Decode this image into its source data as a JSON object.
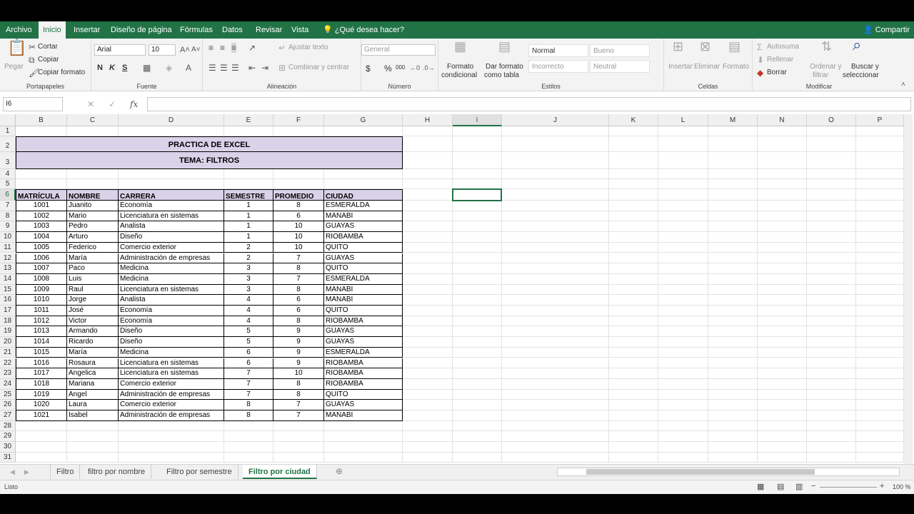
{
  "ribbon_tabs": [
    "Archivo",
    "Inicio",
    "Insertar",
    "Diseño de página",
    "Fórmulas",
    "Datos",
    "Revisar",
    "Vista",
    "¿Qué desea hacer?"
  ],
  "share_label": "Compartir",
  "clipboard": {
    "paste": "Pegar",
    "cut": "Cortar",
    "copy": "Copiar",
    "format_painter": "Copiar formato",
    "label": "Portapapeles"
  },
  "font": {
    "name": "Arial",
    "size": "10",
    "bold": "N",
    "italic": "K",
    "underline": "S",
    "label": "Fuente"
  },
  "alignment": {
    "wrap": "Ajustar texto",
    "merge": "Combinar y centrar",
    "label": "Alineación"
  },
  "number": {
    "format": "General",
    "currency": "$",
    "percent": "%",
    "thousands": "000",
    "label": "Número"
  },
  "styles": {
    "conditional": [
      "Formato",
      "condicional"
    ],
    "table": [
      "Dar formato",
      "como tabla"
    ],
    "cells": [
      "Normal",
      "Bueno",
      "Incorrecto",
      "Neutral"
    ],
    "label": "Estilos"
  },
  "cells": {
    "insert": "Insertar",
    "delete": "Eliminar",
    "format": "Formato",
    "label": "Celdas"
  },
  "editing": {
    "autosum": "Autosuma",
    "fill": "Rellenar",
    "clear": "Borrar",
    "sort": [
      "Ordenar y",
      "filtrar"
    ],
    "find": [
      "Buscar y",
      "seleccionar"
    ],
    "label": "Modificar"
  },
  "name_box": "I6",
  "formula_icons": [
    "✕",
    "✓",
    "fx"
  ],
  "column_headers": [
    "B",
    "C",
    "D",
    "E",
    "F",
    "G",
    "H",
    "I",
    "J",
    "K",
    "L",
    "M",
    "N",
    "O",
    "P"
  ],
  "title1": "PRACTICA DE EXCEL",
  "title2": "TEMA:  FILTROS",
  "table_headers": [
    "MATRÍCULA",
    "NOMBRE",
    "CARRERA",
    "SEMESTRE",
    "PROMEDIO",
    "CIUDAD"
  ],
  "rows": [
    [
      "1001",
      "Juanito",
      "Economía",
      "1",
      "8",
      "ESMERALDA"
    ],
    [
      "1002",
      "Mario",
      "Licenciatura en sistemas",
      "1",
      "6",
      "MANABI"
    ],
    [
      "1003",
      "Pedro",
      "Analista",
      "1",
      "10",
      "GUAYAS"
    ],
    [
      "1004",
      "Arturo",
      "Diseño",
      "1",
      "10",
      "RIOBAMBA"
    ],
    [
      "1005",
      "Federico",
      "Comercio exterior",
      "2",
      "10",
      "QUITO"
    ],
    [
      "1006",
      "María",
      "Administración de empresas",
      "2",
      "7",
      "GUAYAS"
    ],
    [
      "1007",
      "Paco",
      "Medicina",
      "3",
      "8",
      "QUITO"
    ],
    [
      "1008",
      "Luis",
      "Medicina",
      "3",
      "7",
      "ESMERALDA"
    ],
    [
      "1009",
      "Raul",
      "Licenciatura en sistemas",
      "3",
      "8",
      "MANABI"
    ],
    [
      "1010",
      "Jorge",
      "Analista",
      "4",
      "6",
      "MANABI"
    ],
    [
      "1011",
      "José",
      "Economía",
      "4",
      "6",
      "QUITO"
    ],
    [
      "1012",
      "Victor",
      "Economía",
      "4",
      "8",
      "RIOBAMBA"
    ],
    [
      "1013",
      "Armando",
      "Diseño",
      "5",
      "9",
      "GUAYAS"
    ],
    [
      "1014",
      "Ricardo",
      "Diseño",
      "5",
      "9",
      "GUAYAS"
    ],
    [
      "1015",
      "María",
      "Medicina",
      "6",
      "9",
      "ESMERALDA"
    ],
    [
      "1016",
      "Rosaura",
      "Licenciatura en sistemas",
      "6",
      "9",
      "RIOBAMBA"
    ],
    [
      "1017",
      "Angelica",
      "Licenciatura en sistemas",
      "7",
      "10",
      "RIOBAMBA"
    ],
    [
      "1018",
      "Mariana",
      "Comercio exterior",
      "7",
      "8",
      "RIOBAMBA"
    ],
    [
      "1019",
      "Angel",
      "Administración de empresas",
      "7",
      "8",
      "QUITO"
    ],
    [
      "1020",
      "Laura",
      "Comercio exterior",
      "8",
      "7",
      "GUAYAS"
    ],
    [
      "1021",
      "Isabel",
      "Administración de empresas",
      "8",
      "7",
      "MANABI"
    ]
  ],
  "sheet_tabs": [
    "Filtro",
    "filtro por nombre",
    "Filtro por semestre",
    "Filtro por ciudad"
  ],
  "active_sheet": "Filtro por ciudad",
  "status_text": "Listo",
  "zoom": "100 %",
  "accent": "#217346",
  "header_fill": "#d9d2e9"
}
